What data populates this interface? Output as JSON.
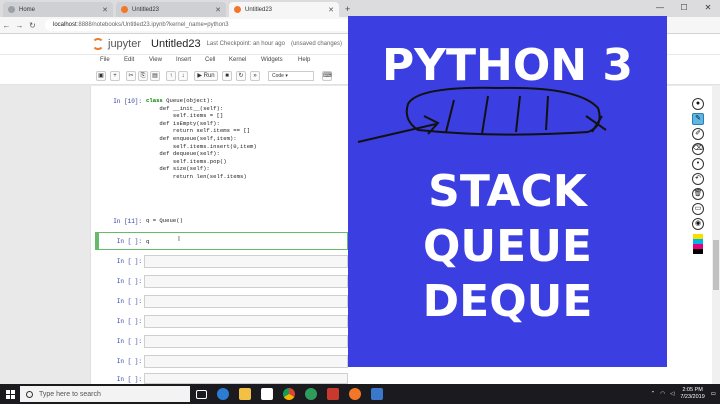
{
  "browser": {
    "tabs": [
      {
        "label": "Home",
        "active": false
      },
      {
        "label": "Untitled23",
        "active": false
      },
      {
        "label": "Untitled23",
        "active": true
      }
    ],
    "url_host": "localhost",
    "url_path": ":8888/notebooks/Untitled23.ipynb?kernel_name=python3"
  },
  "jupyter": {
    "brand": "jupyter",
    "notebook_title": "Untitled23",
    "checkpoint": "Last Checkpoint: an hour ago",
    "unsaved": "(unsaved changes)",
    "menu": [
      "File",
      "Edit",
      "View",
      "Insert",
      "Cell",
      "Kernel",
      "Widgets",
      "Help"
    ],
    "run_label": "Run",
    "cell_type": "Code"
  },
  "cells": {
    "c1_prompt": "In [10]:",
    "c1_code": [
      "class Queue(object):",
      "    def __init__(self):",
      "        self.items = []",
      "    def isEmpty(self):",
      "        return self.items == []",
      "    def enqueue(self,item):",
      "        self.items.insert(0,item)",
      "    def dequeue(self):",
      "        self.items.pop()",
      "    def size(self):",
      "        return len(self.items)"
    ],
    "c2_prompt": "In [11]:",
    "c2_code": "q = Queue()",
    "c3_prompt": "In [ ]:",
    "c3_code": "q",
    "empty_prompt": "In [ ]:"
  },
  "slide": {
    "line1": "PYTHON 3",
    "line2": "STACK",
    "line3": "QUEUE",
    "line4": "DEQUE",
    "bg_color": "#3b3ee0"
  },
  "taskbar": {
    "search_placeholder": "Type here to search",
    "time": "2:05 PM",
    "date": "7/23/2019"
  }
}
